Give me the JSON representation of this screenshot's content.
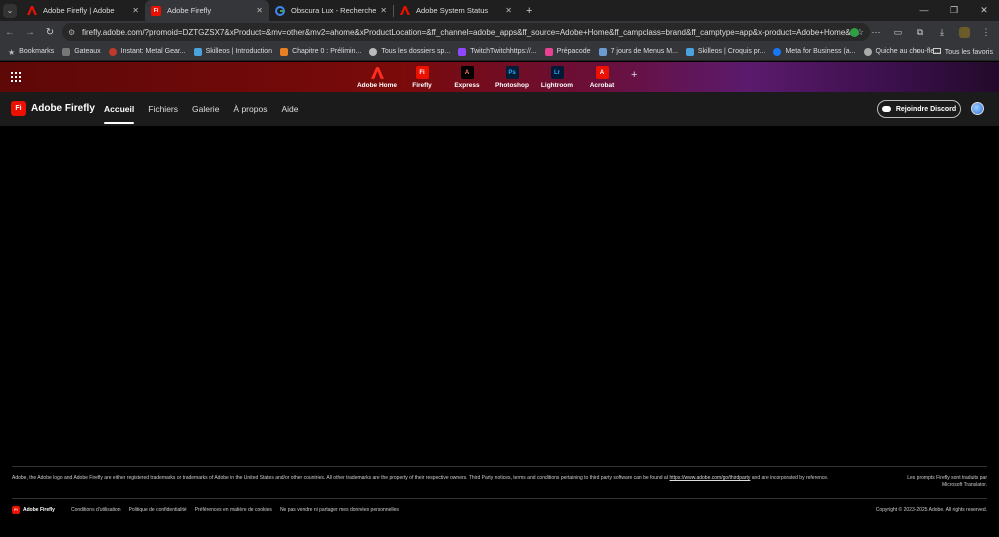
{
  "tabs": [
    {
      "title": "Adobe Firefly | Adobe",
      "active": false
    },
    {
      "title": "Adobe Firefly",
      "active": true
    },
    {
      "title": "Obscura Lux - Recherche Googl",
      "active": false
    },
    {
      "title": "Adobe System Status",
      "active": false
    }
  ],
  "omnibox": {
    "url": "firefly.adobe.com/?promoid=DZTGZSX7&xProduct=&mv=other&mv2=ahome&xProductLocation=&ff_channel=adobe_apps&ff_source=Adobe+Home&ff_campclass=brand&ff_camptype=app&x-product=Adobe+Home&ff_content=Ap..."
  },
  "bookmarks": [
    {
      "label": "Bookmarks",
      "color": "#bbbbbb"
    },
    {
      "label": "Gateaux",
      "color": "#777777"
    },
    {
      "label": "Instant: Metal Gear...",
      "color": "#c0392b"
    },
    {
      "label": "Skilleos | Introduction",
      "color": "#4aa3df"
    },
    {
      "label": "Chapitre 0 : Prélimin...",
      "color": "#e67e22"
    },
    {
      "label": "Tous les dossiers sp...",
      "color": "#bbbbbb"
    },
    {
      "label": "TwitchTwitchhttps://...",
      "color": "#9146ff"
    },
    {
      "label": "Prépacode",
      "color": "#e84393"
    },
    {
      "label": "7 jours de Menus M...",
      "color": "#6c9bd2"
    },
    {
      "label": "Skilleos | Croquis pr...",
      "color": "#4aa3df"
    },
    {
      "label": "Meta for Business (a...",
      "color": "#1877f2"
    },
    {
      "label": "Quiche au chou-fle...",
      "color": "#aaaaaa"
    }
  ],
  "bookmarks_right": {
    "more": "»",
    "all": "Tous les favoris"
  },
  "apps": [
    {
      "label": "Adobe Home",
      "badge": "A",
      "bg": "#eb1000",
      "fg": "#ffffff"
    },
    {
      "label": "Firefly",
      "badge": "Fi",
      "bg": "#eb1000",
      "fg": "#ffffff"
    },
    {
      "label": "Express",
      "badge": "A",
      "bg": "#000000",
      "fg": "#ff7a5a"
    },
    {
      "label": "Photoshop",
      "badge": "Ps",
      "bg": "#001e36",
      "fg": "#31a8ff"
    },
    {
      "label": "Lightroom",
      "badge": "Lr",
      "bg": "#001a36",
      "fg": "#31a8ff"
    },
    {
      "label": "Acrobat",
      "badge": "A",
      "bg": "#eb1000",
      "fg": "#ffffff"
    }
  ],
  "firefly": {
    "logo_badge": "Fi",
    "title": "Adobe Firefly",
    "nav": [
      {
        "label": "Accueil",
        "active": true
      },
      {
        "label": "Fichiers",
        "active": false
      },
      {
        "label": "Galerie",
        "active": false
      },
      {
        "label": "À propos",
        "active": false
      },
      {
        "label": "Aide",
        "active": false
      }
    ],
    "discord_label": "Rejoindre Discord"
  },
  "footer": {
    "legal_before": "Adobe, the Adobe logo and Adobe Firefly are either registered trademarks or trademarks of Adobe in the United States and/or other countries. All other trademarks are the property of their respective owners. Third Party notices, terms and conditions pertaining to third party software can be found at ",
    "legal_link": "https://www.adobe.com/go/thirdparty",
    "legal_after": " and are incorporated by reference.",
    "translate_note": "Les prompts Firefly sont traduits par Microsoft Translator.",
    "brand": "Adobe Firefly",
    "links": [
      "Conditions d'utilisation",
      "Politique de confidentialité",
      "Préférences en matière de cookies",
      "Ne pas vendre ni partager mes données personnelles"
    ],
    "copyright": "Copyright © 2023-2025 Adobe. All rights reserved."
  }
}
